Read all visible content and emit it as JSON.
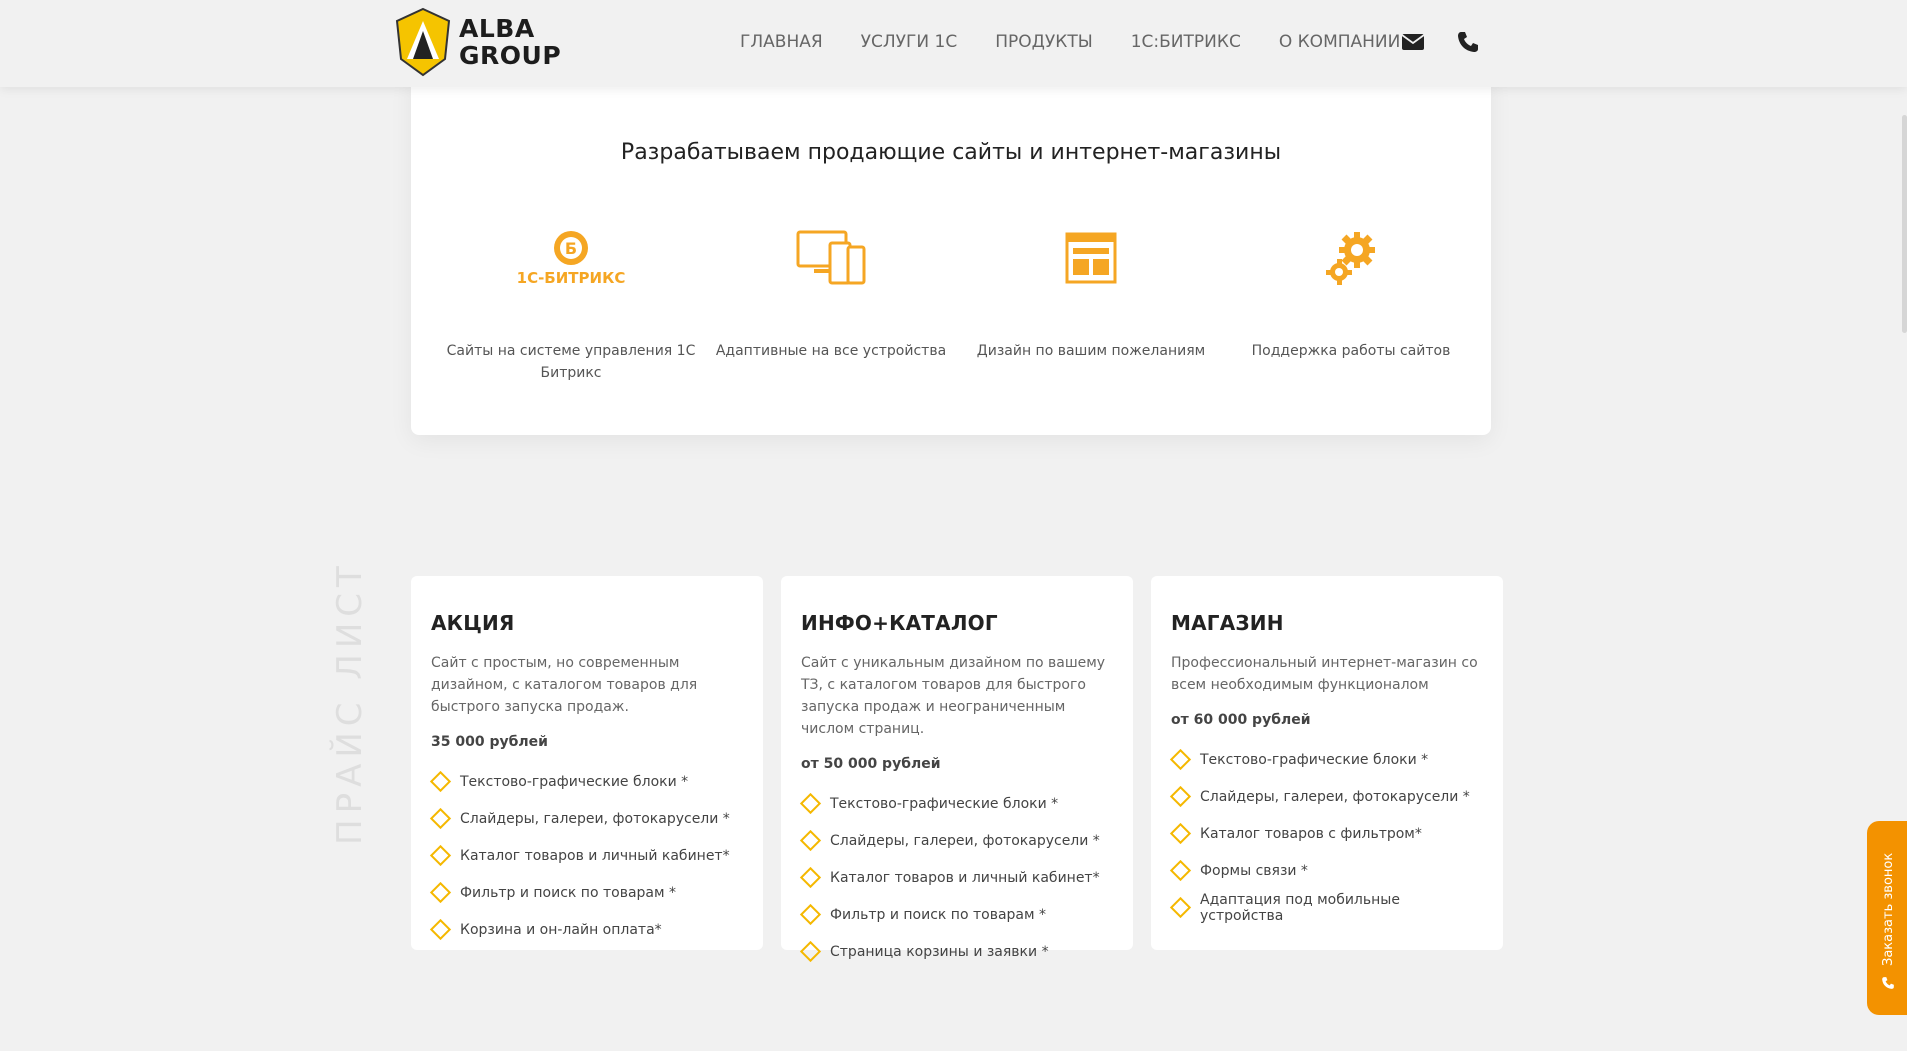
{
  "header": {
    "logo": {
      "line1": "ALBA",
      "line2": "GROUP"
    },
    "nav": [
      "ГЛАВНАЯ",
      "УСЛУГИ 1С",
      "ПРОДУКТЫ",
      "1С:БИТРИКС",
      "О КОМПАНИИ"
    ],
    "icons": [
      "envelope-icon",
      "phone-icon"
    ]
  },
  "features": {
    "title": "Разрабатываем продающие сайты и интернет-магазины",
    "bitrix_logo_text": "1С-БИТРИКС",
    "items": [
      {
        "icon": "bitrix-logo",
        "label": "Сайты на системе управления 1С Битрикс"
      },
      {
        "icon": "devices-icon",
        "label": "Адаптивные на все устройства"
      },
      {
        "icon": "layout-icon",
        "label": "Дизайн по вашим пожеланиям"
      },
      {
        "icon": "gears-icon",
        "label": "Поддержка работы сайтов"
      }
    ]
  },
  "side_text": "ПРАЙС ЛИСТ",
  "prices": [
    {
      "name": "АКЦИЯ",
      "desc": "Сайт с простым, но современным дизайном, с каталогом товаров для быстрого запуска продаж.",
      "price": "35 000 рублей",
      "items": [
        "Текстово-графические блоки *",
        "Слайдеры, галереи, фотокарусели *",
        "Каталог товаров и личный кабинет*",
        "Фильтр и поиск по товарам *",
        "Корзина и он-лайн оплата*"
      ]
    },
    {
      "name": "ИНФО+КАТАЛОГ",
      "desc": "Сайт с уникальным дизайном по вашему ТЗ, с каталогом товаров для быстрого запуска продаж и неограниченным числом страниц.",
      "price": "от 50 000 рублей",
      "items": [
        "Текстово-графические блоки *",
        "Слайдеры, галереи, фотокарусели *",
        "Каталог товаров и личный кабинет*",
        "Фильтр и поиск по товарам *",
        "Страница корзины и заявки *"
      ]
    },
    {
      "name": "МАГАЗИН",
      "desc": "Профессиональный интернет-магазин со всем необходимым функционалом",
      "price": "от 60 000 рублей",
      "items": [
        "Текстово-графические блоки *",
        "Слайдеры, галереи, фотокарусели *",
        "Каталог товаров с фильтром*",
        "Формы связи *",
        "Адаптация под мобильные устройства"
      ]
    }
  ],
  "callback": {
    "label": "Заказать звонок"
  },
  "colors": {
    "accent": "#f39200",
    "bullet": "#f5b800",
    "background": "#f1f1f1"
  }
}
